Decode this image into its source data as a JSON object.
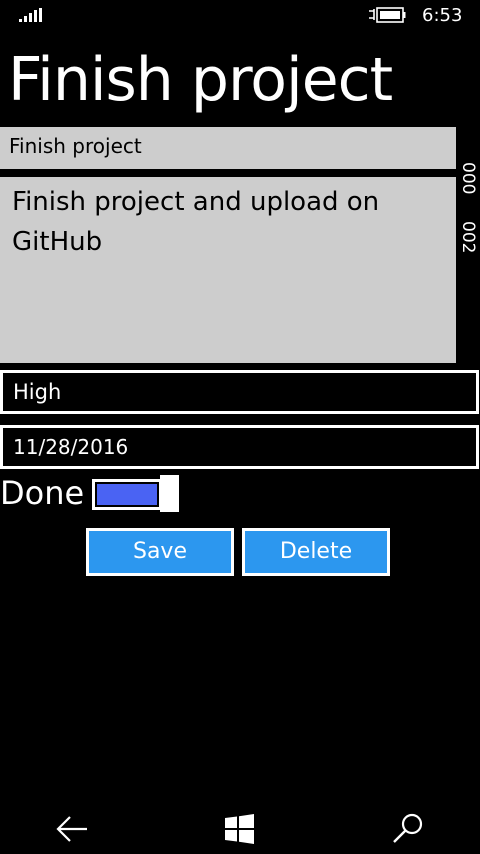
{
  "status_bar": {
    "signal_icon": "signal-strength-icon",
    "battery_icon": "battery-charging-icon",
    "time": "6:53"
  },
  "page": {
    "title": "Finish project"
  },
  "form": {
    "task_title": "Finish project",
    "notes": "Finish project and upload on GitHub",
    "side_counter_top": "000",
    "side_counter_bottom": "002",
    "priority": "High",
    "due_date": "11/28/2016",
    "done_label": "Done",
    "done_toggle_on": true
  },
  "actions": {
    "save_label": "Save",
    "delete_label": "Delete"
  },
  "nav_bar": {
    "back_icon": "back-arrow-icon",
    "start_icon": "windows-logo-icon",
    "search_icon": "search-icon"
  },
  "colors": {
    "background": "#000000",
    "field_background": "#cdcdcd",
    "button_accent": "#2c97ef",
    "toggle_fill": "#4a63f3"
  }
}
